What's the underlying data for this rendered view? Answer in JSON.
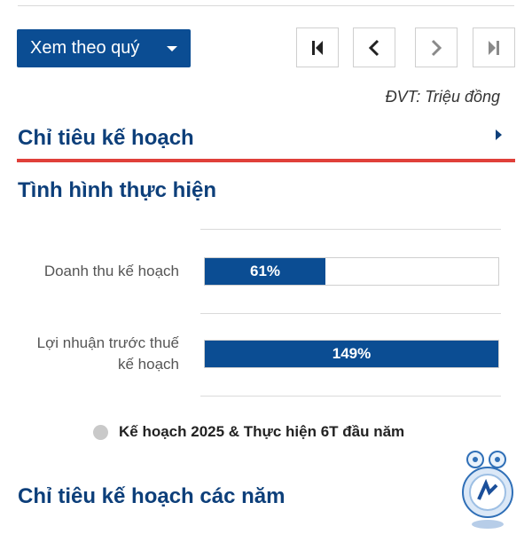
{
  "toolbar": {
    "period_label": "Xem theo quý",
    "nav_buttons": [
      "first-page-icon",
      "previous-icon",
      "next-icon",
      "last-page-icon"
    ]
  },
  "unit_label": "ĐVT: Triệu đồng",
  "sections": {
    "plan_title": "Chỉ tiêu kế hoạch",
    "performance_title": "Tình hình thực hiện",
    "years_title": "Chỉ tiêu kế hoạch các năm"
  },
  "chart_data": {
    "type": "bar",
    "orientation": "horizontal",
    "categories": [
      "Doanh thu kế hoạch",
      "Lợi nhuận trước thuế kế hoạch"
    ],
    "values": [
      61,
      149
    ],
    "value_labels": [
      "61%",
      "149%"
    ],
    "unit": "%",
    "series": [
      {
        "name": "Kế hoạch 2025 & Thực hiện 6T đầu năm",
        "values": [
          61,
          149
        ]
      }
    ],
    "legend": "bottom",
    "grid": true,
    "bar_color": "#0b4d93"
  },
  "category_lines": [
    [
      "Doanh thu kế hoạch"
    ],
    [
      "Lợi nhuận trước thuế",
      "kế hoạch"
    ]
  ],
  "colors": {
    "primary": "#0b4d93",
    "title": "#0d3f7a",
    "accent_rule": "#e0403a",
    "legend_dot": "#c9c9c9"
  }
}
